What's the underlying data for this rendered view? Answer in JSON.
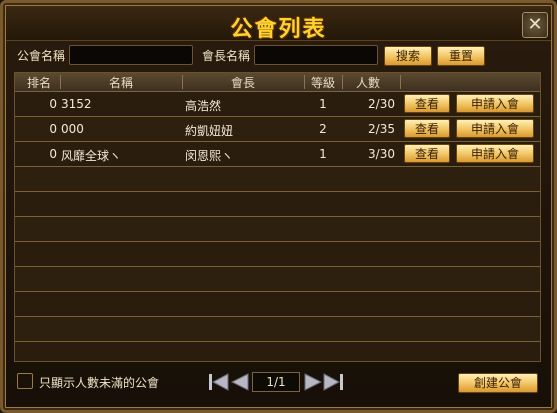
{
  "window": {
    "title": "公會列表",
    "close_icon": "close-icon"
  },
  "search": {
    "guild_name_label": "公會名稱",
    "guild_name_value": "",
    "leader_name_label": "會長名稱",
    "leader_name_value": "",
    "search_label": "搜索",
    "reset_label": "重置"
  },
  "table": {
    "headers": [
      "排名",
      "名稱",
      "會長",
      "等級",
      "人數"
    ],
    "view_label": "查看",
    "apply_label": "申請入會",
    "rows": [
      {
        "rank": "0",
        "name": "3152",
        "leader": "高浩然",
        "level": "1",
        "members": "2/30"
      },
      {
        "rank": "0",
        "name": "000",
        "leader": "約凱妞妞",
        "level": "2",
        "members": "2/35"
      },
      {
        "rank": "0",
        "name": "风靡全球ヽ",
        "leader": "闵恩熙ヽ",
        "level": "1",
        "members": "3/30"
      }
    ],
    "empty_rows": 8
  },
  "footer": {
    "filter_label": "只顯示人數未滿的公會",
    "filter_checked": false,
    "page": "1/1",
    "create_label": "創建公會"
  },
  "colors": {
    "accent": "#ffd230",
    "button": "#f3c868",
    "panel": "#2a1d0e",
    "border": "#7a6036"
  }
}
